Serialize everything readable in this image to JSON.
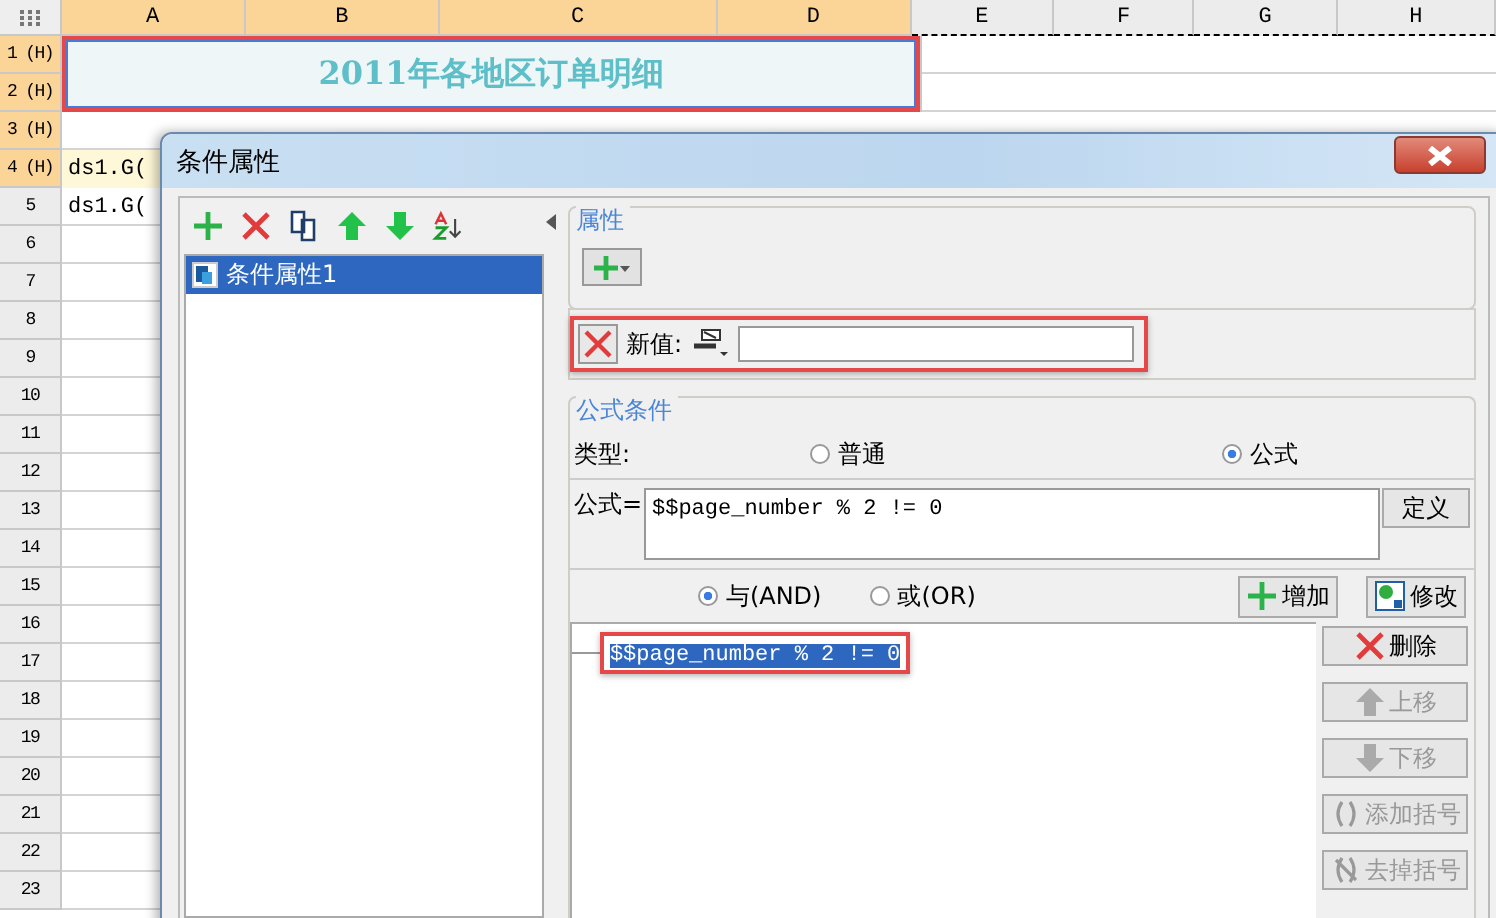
{
  "spreadsheet": {
    "columns": [
      {
        "label": "A",
        "selected": true
      },
      {
        "label": "B",
        "selected": true
      },
      {
        "label": "C",
        "selected": true
      },
      {
        "label": "D",
        "selected": true
      },
      {
        "label": "E",
        "selected": false
      },
      {
        "label": "F",
        "selected": false
      },
      {
        "label": "G",
        "selected": false
      },
      {
        "label": "H",
        "selected": false
      }
    ],
    "rows": [
      {
        "label": "1 (H)",
        "selected": true
      },
      {
        "label": "2 (H)",
        "selected": true
      },
      {
        "label": "3 (H)",
        "selected": true
      },
      {
        "label": "4 (H)",
        "selected": true
      },
      {
        "label": "5",
        "selected": false
      },
      {
        "label": "6",
        "selected": false
      },
      {
        "label": "7",
        "selected": false
      },
      {
        "label": "8",
        "selected": false
      },
      {
        "label": "9",
        "selected": false
      },
      {
        "label": "10",
        "selected": false
      },
      {
        "label": "11",
        "selected": false
      },
      {
        "label": "12",
        "selected": false
      },
      {
        "label": "13",
        "selected": false
      },
      {
        "label": "14",
        "selected": false
      },
      {
        "label": "15",
        "selected": false
      },
      {
        "label": "16",
        "selected": false
      },
      {
        "label": "17",
        "selected": false
      },
      {
        "label": "18",
        "selected": false
      },
      {
        "label": "19",
        "selected": false
      },
      {
        "label": "20",
        "selected": false
      },
      {
        "label": "21",
        "selected": false
      },
      {
        "label": "22",
        "selected": false
      },
      {
        "label": "23",
        "selected": false
      }
    ],
    "title": "2011年各地区订单明细",
    "data_cells": [
      "ds1.G(",
      "ds1.G("
    ]
  },
  "dialog": {
    "title": "条件属性",
    "conditions": [
      {
        "label": "条件属性1",
        "selected": true
      }
    ],
    "properties": {
      "legend": "属性",
      "new_value_label": "新值:"
    },
    "formula_condition": {
      "legend": "公式条件",
      "type_label": "类型:",
      "types": [
        {
          "label": "普通",
          "selected": false
        },
        {
          "label": "公式",
          "selected": true
        }
      ],
      "formula_label": "公式=",
      "formula": "$$page_number % 2 != 0",
      "define_button": "定义"
    },
    "logic": [
      {
        "label": "与(AND)",
        "selected": true
      },
      {
        "label": "或(OR)",
        "selected": false
      }
    ],
    "add_button": "增加",
    "modify_button": "修改",
    "expressions": [
      {
        "text": "$$page_number % 2 != 0",
        "selected": true
      }
    ],
    "side_buttons": [
      {
        "label": "删除",
        "kind": "delete",
        "disabled": false
      },
      {
        "label": "上移",
        "kind": "up",
        "disabled": true
      },
      {
        "label": "下移",
        "kind": "down",
        "disabled": true
      },
      {
        "label": "添加括号",
        "kind": "add-paren",
        "disabled": true
      },
      {
        "label": "去掉括号",
        "kind": "remove-paren",
        "disabled": true
      }
    ]
  }
}
